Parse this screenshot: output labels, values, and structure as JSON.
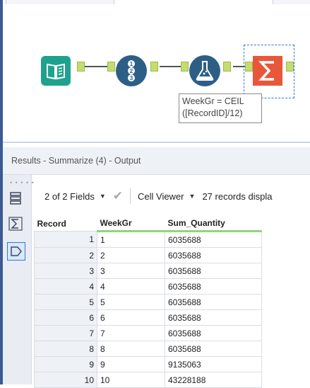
{
  "workflow": {
    "annotation_line1": "WeekGr = CEIL",
    "annotation_line2": "([RecordID]/12)",
    "tools": [
      {
        "name": "input-data-tool",
        "icon": "book-icon"
      },
      {
        "name": "record-id-tool",
        "icon": "numbered-list-icon"
      },
      {
        "name": "formula-tool",
        "icon": "flask-icon"
      },
      {
        "name": "summarize-tool",
        "icon": "sigma-icon"
      }
    ]
  },
  "results": {
    "title": "Results - Summarize (4) - Output",
    "toolbar": {
      "fields": "2 of 2 Fields",
      "viewer": "Cell Viewer",
      "records": "27 records displa"
    },
    "columns": [
      "Record",
      "WeekGr",
      "Sum_Quantity"
    ],
    "rows": [
      [
        "1",
        "1",
        "6035688"
      ],
      [
        "2",
        "2",
        "6035688"
      ],
      [
        "3",
        "3",
        "6035688"
      ],
      [
        "4",
        "4",
        "6035688"
      ],
      [
        "5",
        "5",
        "6035688"
      ],
      [
        "6",
        "6",
        "6035688"
      ],
      [
        "7",
        "7",
        "6035688"
      ],
      [
        "8",
        "8",
        "6035688"
      ],
      [
        "9",
        "9",
        "9135063"
      ],
      [
        "10",
        "10",
        "43228188"
      ]
    ]
  },
  "colors": {
    "accent": "#2e78d6",
    "input_tool": "#1fa28d",
    "tool_blue": "#2d5f86",
    "summarize": "#e8573a",
    "anchor": "#c5dc6f"
  }
}
